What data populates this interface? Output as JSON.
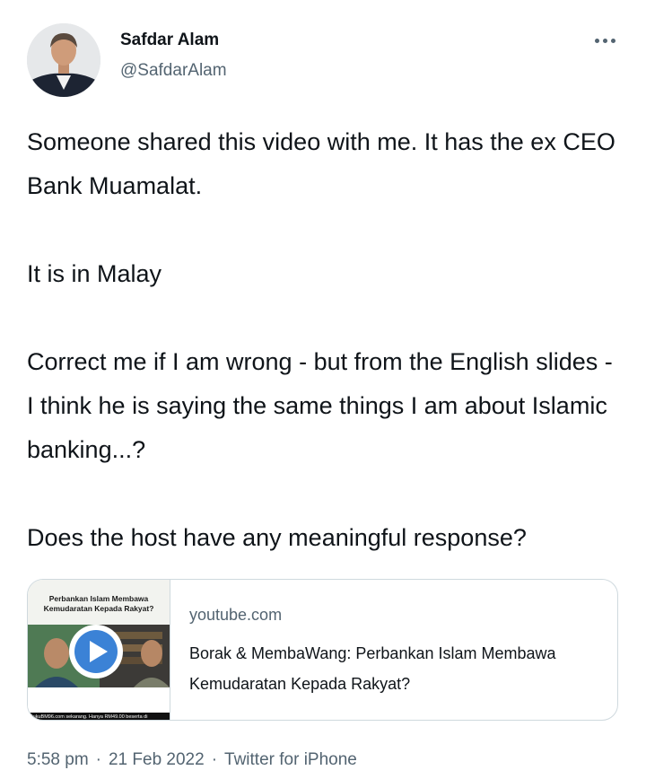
{
  "author": {
    "name": "Safdar Alam",
    "handle": "@SafdarAlam"
  },
  "tweet": {
    "paragraphs": [
      "Someone shared this video with me. It has the ex CEO Bank Muamalat.",
      "It is in Malay",
      "Correct me if I am wrong - but from the English slides - I think he is saying the same things I am about Islamic banking...?",
      "Does the host have any meaningful response?"
    ]
  },
  "card": {
    "thumb_title": "Perbankan Islam Membawa Kemudaratan Kepada Rakyat?",
    "thumb_ticker": "BukuBM96.com sekarang. Hanya RM49.00 beserta di",
    "domain": "youtube.com",
    "title": "Borak & MembaWang: Perbankan Islam Membawa Kemudaratan Kepada Rakyat?"
  },
  "meta": {
    "time": "5:58 pm",
    "date": "21 Feb 2022",
    "separator": "·",
    "source": "Twitter for iPhone"
  },
  "colors": {
    "text": "#0f1419",
    "secondary": "#536471",
    "border": "#cfd9de",
    "play": "#3b82d6"
  },
  "icons": {
    "more": "more-horizontal-icon",
    "play": "play-icon"
  }
}
